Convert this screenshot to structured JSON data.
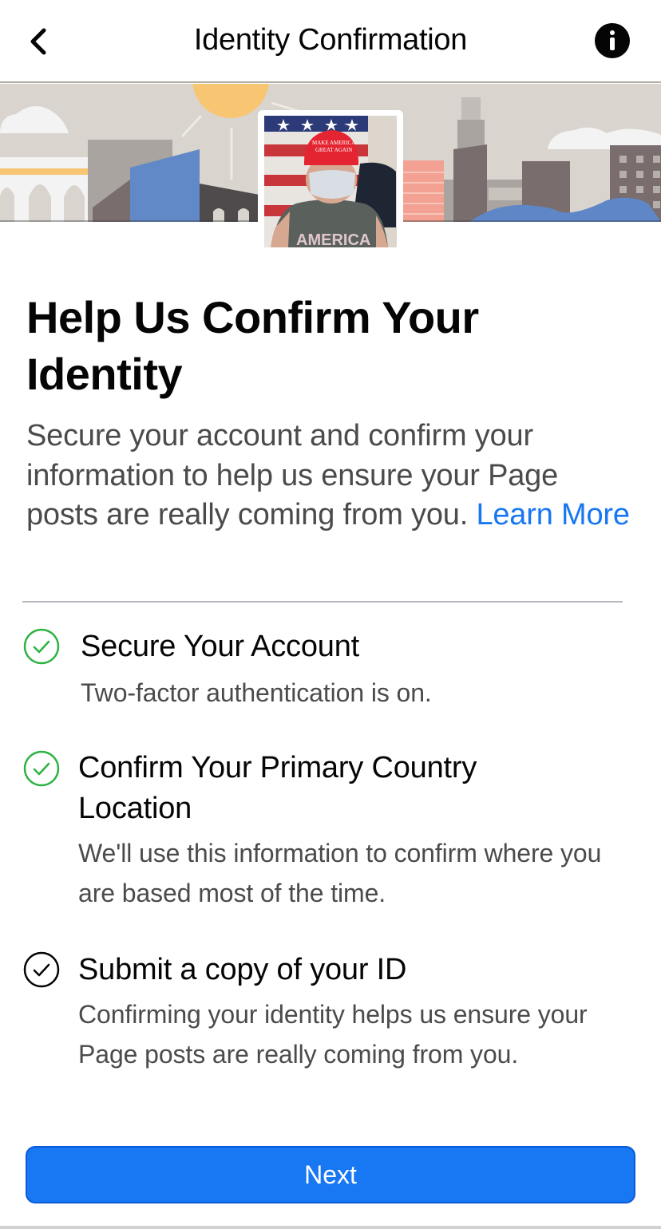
{
  "header": {
    "title": "Identity Confirmation",
    "back_icon": "chevron-left-icon",
    "info_icon": "info-icon"
  },
  "banner": {
    "illustration": "city-skyline-illustration",
    "profile_photo": "profile-photo",
    "colors": {
      "sky": "#d9d5ce",
      "sun": "#f8c573",
      "building_blue": "#6188c7",
      "building_dark": "#7a6d6e",
      "building_gray": "#a9a4a0",
      "building_pink": "#f2a193",
      "cloud": "#f3f3f3",
      "water": "#5f86c6"
    }
  },
  "main": {
    "headline": "Help Us Confirm Your Identity",
    "intro_text": "Secure your account and confirm your information to help us ensure your Page posts are really coming from you.",
    "learn_more_label": "Learn More"
  },
  "steps": [
    {
      "title": "Secure Your Account",
      "description": "Two-factor authentication is on.",
      "status": "complete",
      "icon": "check-circle-icon",
      "icon_color": "#2db342"
    },
    {
      "title": "Confirm Your Primary Country Location",
      "description": "We'll use this information to confirm where you are based most of the time.",
      "status": "complete",
      "icon": "check-circle-icon",
      "icon_color": "#2db342"
    },
    {
      "title": "Submit a copy of your ID",
      "description": "Confirming your identity helps us ensure your Page posts are really coming from you.",
      "status": "pending",
      "icon": "check-circle-icon",
      "icon_color": "#050505"
    }
  ],
  "footer": {
    "next_label": "Next",
    "accent_color": "#1877f2"
  }
}
